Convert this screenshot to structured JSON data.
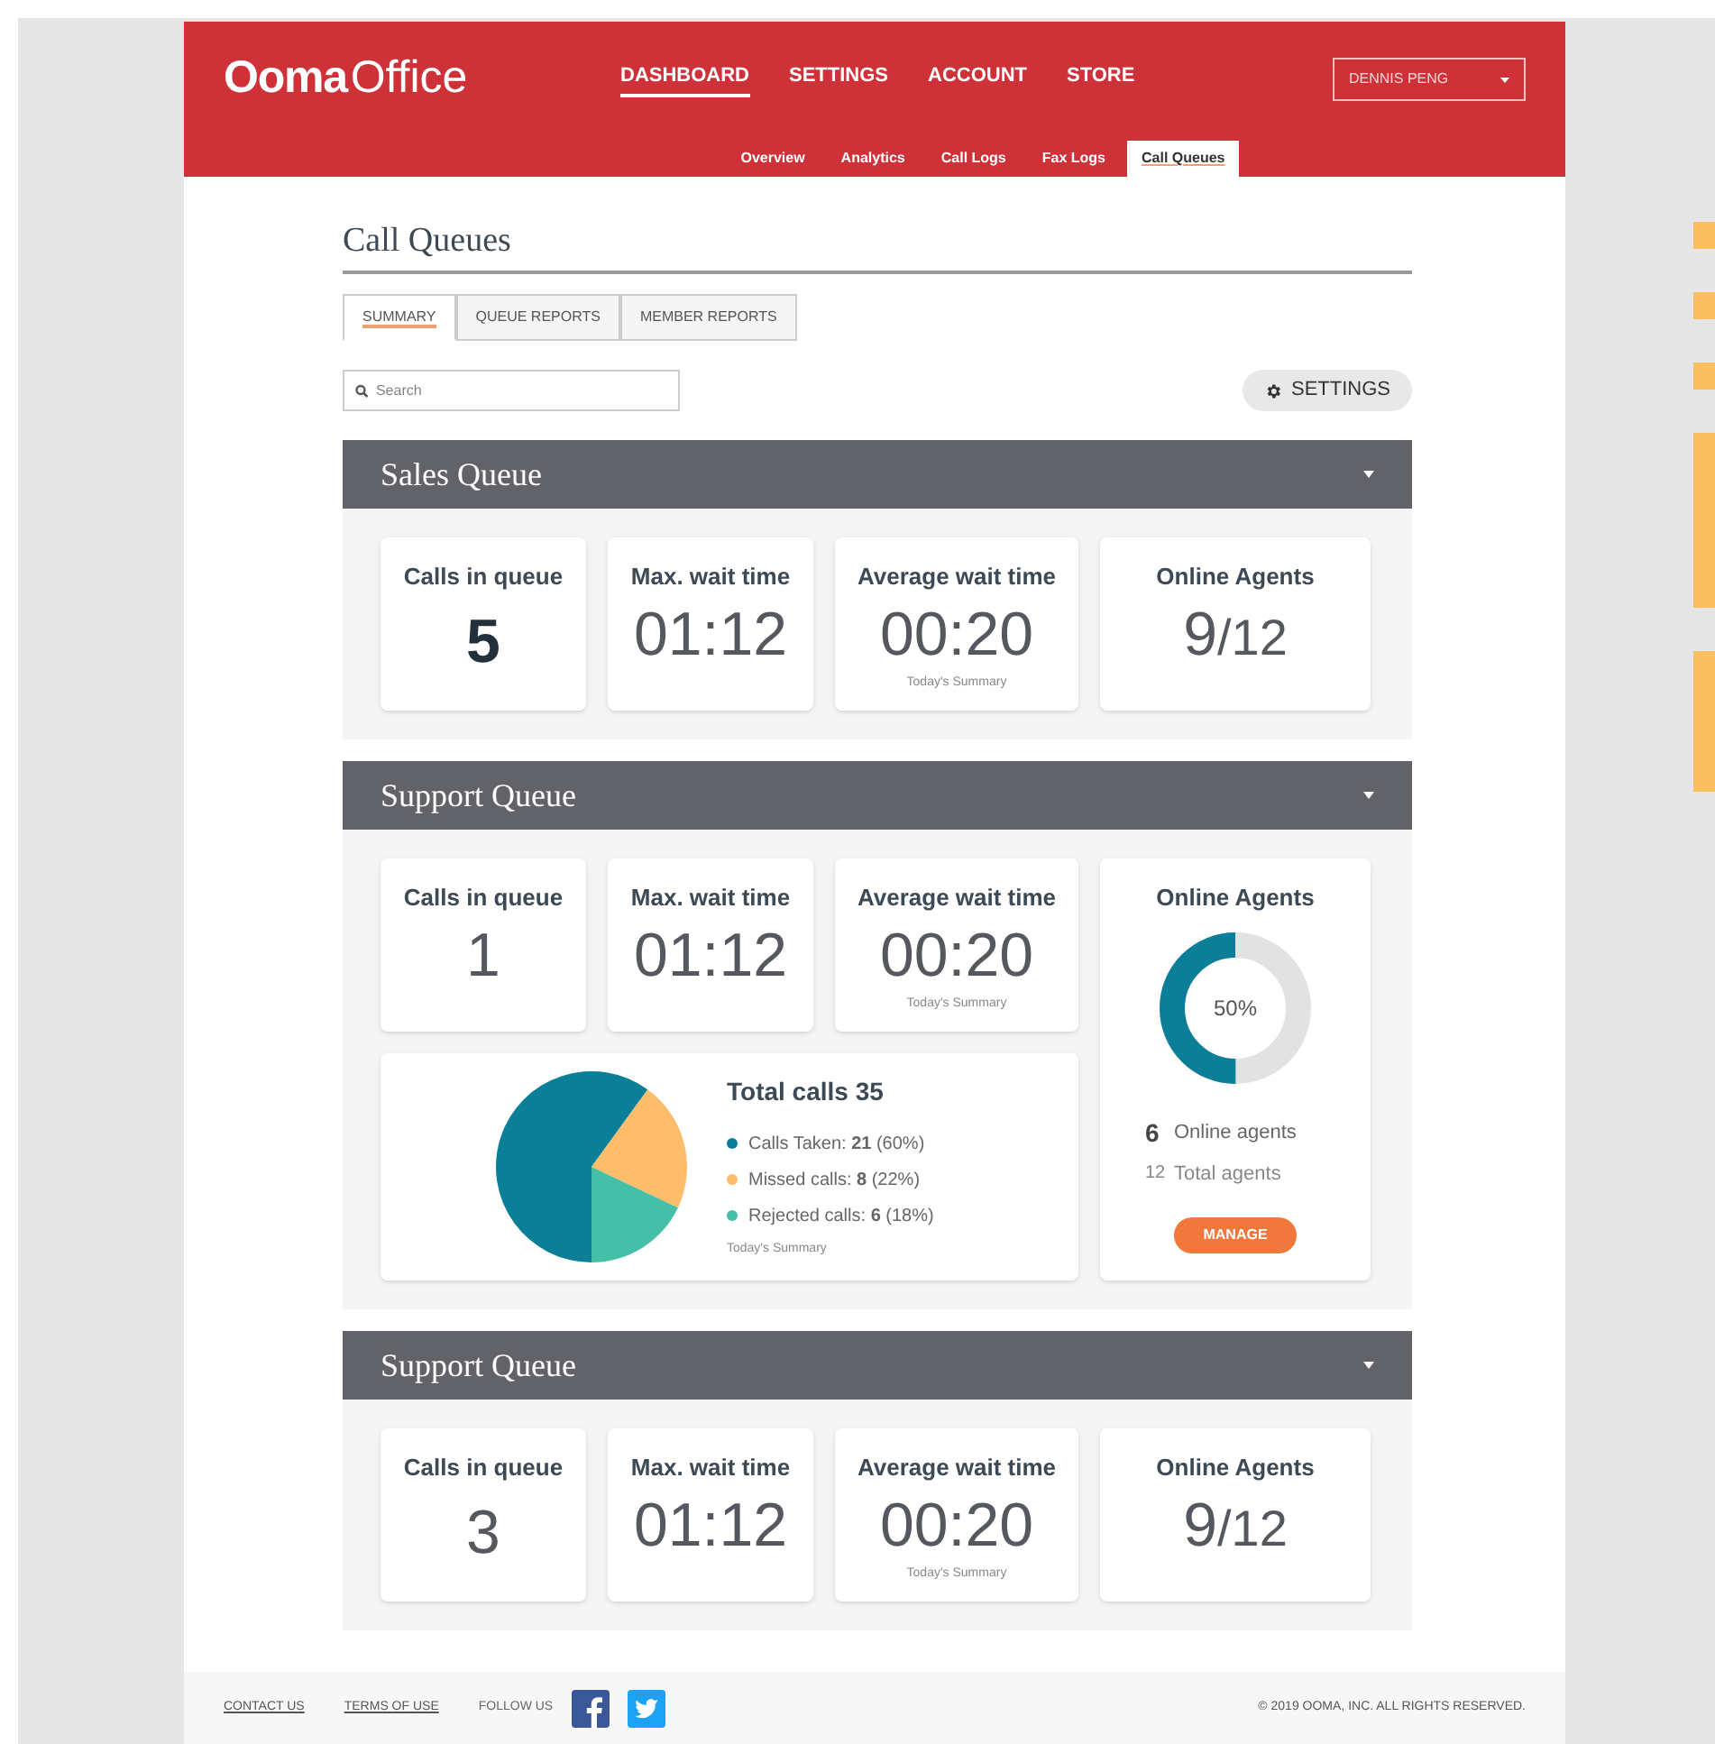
{
  "header": {
    "logo_main": "Ooma",
    "logo_sub": "Office",
    "nav": [
      {
        "label": "DASHBOARD",
        "selected": true
      },
      {
        "label": "SETTINGS",
        "selected": false
      },
      {
        "label": "ACCOUNT",
        "selected": false
      },
      {
        "label": "STORE",
        "selected": false
      }
    ],
    "user_menu": "DENNIS PENG",
    "subnav": [
      {
        "label": "Overview",
        "selected": false
      },
      {
        "label": "Analytics",
        "selected": false
      },
      {
        "label": "Call Logs",
        "selected": false
      },
      {
        "label": "Fax Logs",
        "selected": false
      },
      {
        "label": "Call Queues",
        "selected": true
      }
    ]
  },
  "page_title": "Call Queues",
  "tabs": [
    {
      "label": "SUMMARY",
      "selected": true
    },
    {
      "label": "QUEUE REPORTS",
      "selected": false
    },
    {
      "label": "MEMBER REPORTS",
      "selected": false
    }
  ],
  "search": {
    "placeholder": "Search"
  },
  "settings_button": "SETTINGS",
  "queues": [
    {
      "kind": "simple",
      "title": "Sales Queue",
      "stats": [
        {
          "label": "Calls in queue",
          "value": "5",
          "emphasis": true
        },
        {
          "label": "Max. wait time",
          "value": "01:12",
          "emphasis": false
        },
        {
          "label": "Average wait time",
          "value": "00:20",
          "emphasis": false,
          "note": "Today's Summary"
        },
        {
          "label": "Online Agents",
          "value": "9",
          "total": "/12",
          "emphasis": false
        }
      ]
    },
    {
      "kind": "detailed",
      "title": "Support Queue",
      "stats": [
        {
          "label": "Calls in queue",
          "value": "1",
          "emphasis": false
        },
        {
          "label": "Max. wait time",
          "value": "01:12",
          "emphasis": false
        },
        {
          "label": "Average wait time",
          "value": "00:20",
          "emphasis": false,
          "note": "Today's Summary"
        }
      ],
      "calls": {
        "title": "Total calls 35",
        "legend": [
          {
            "text": "Calls Taken: **21** (60%)",
            "color": "#0b7f97"
          },
          {
            "text": "Missed calls: **8** (22%)",
            "color": "#fdbd6a"
          },
          {
            "text": "Rejected calls: **6** (18%)",
            "color": "#45bfa8"
          }
        ],
        "note": "Today's Summary",
        "chart_data": {
          "type": "pie",
          "values": [
            60,
            22,
            18
          ]
        }
      },
      "agents": {
        "title": "Online Agents",
        "level": 0.5,
        "percent": "50%",
        "online_count": "6",
        "online_label": "Online agents",
        "total_count": "12",
        "total_label": "Total agents",
        "button": "MANAGE"
      }
    },
    {
      "kind": "simple",
      "title": "Support Queue",
      "stats": [
        {
          "label": "Calls in queue",
          "value": "3",
          "emphasis": false
        },
        {
          "label": "Max. wait time",
          "value": "01:12",
          "emphasis": false
        },
        {
          "label": "Average wait time",
          "value": "00:20",
          "emphasis": false,
          "note": "Today's Summary"
        },
        {
          "label": "Online Agents",
          "value": "9",
          "total": "/12",
          "emphasis": false
        }
      ]
    }
  ],
  "footer": {
    "links": [
      "CONTACT US",
      "TERMS OF USE"
    ],
    "follow": "FOLLOW US",
    "copyright": "© 2019 OOMA, INC. ALL RIGHTS RESERVED."
  }
}
